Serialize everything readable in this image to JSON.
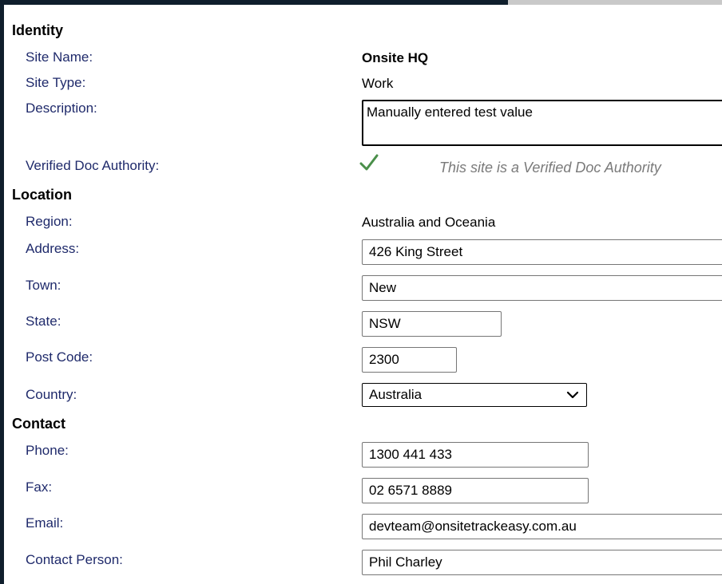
{
  "sections": {
    "identity": "Identity",
    "location": "Location",
    "contact": "Contact"
  },
  "identity": {
    "site_name_label": "Site Name:",
    "site_name_value": "Onsite HQ",
    "site_type_label": "Site Type:",
    "site_type_value": "Work",
    "description_label": "Description:",
    "description_value": "Manually entered test value",
    "verified_label": "Verified Doc Authority:",
    "verified_note": "This site is a Verified Doc Authority",
    "verified_icon": "checkmark-icon",
    "verified_color": "#4a8f4a"
  },
  "location": {
    "region_label": "Region:",
    "region_value": "Australia and Oceania",
    "address_label": "Address:",
    "address_value": "426 King Street",
    "town_label": "Town:",
    "town_value": "New",
    "state_label": "State:",
    "state_value": "NSW",
    "postcode_label": "Post Code:",
    "postcode_value": "2300",
    "country_label": "Country:",
    "country_value": "Australia"
  },
  "contact": {
    "phone_label": "Phone:",
    "phone_value": "1300 441 433",
    "fax_label": "Fax:",
    "fax_value": "02 6571 8889",
    "email_label": "Email:",
    "email_value": "devteam@onsitetrackeasy.com.au",
    "person_label": "Contact Person:",
    "person_value": "Phil Charley"
  }
}
